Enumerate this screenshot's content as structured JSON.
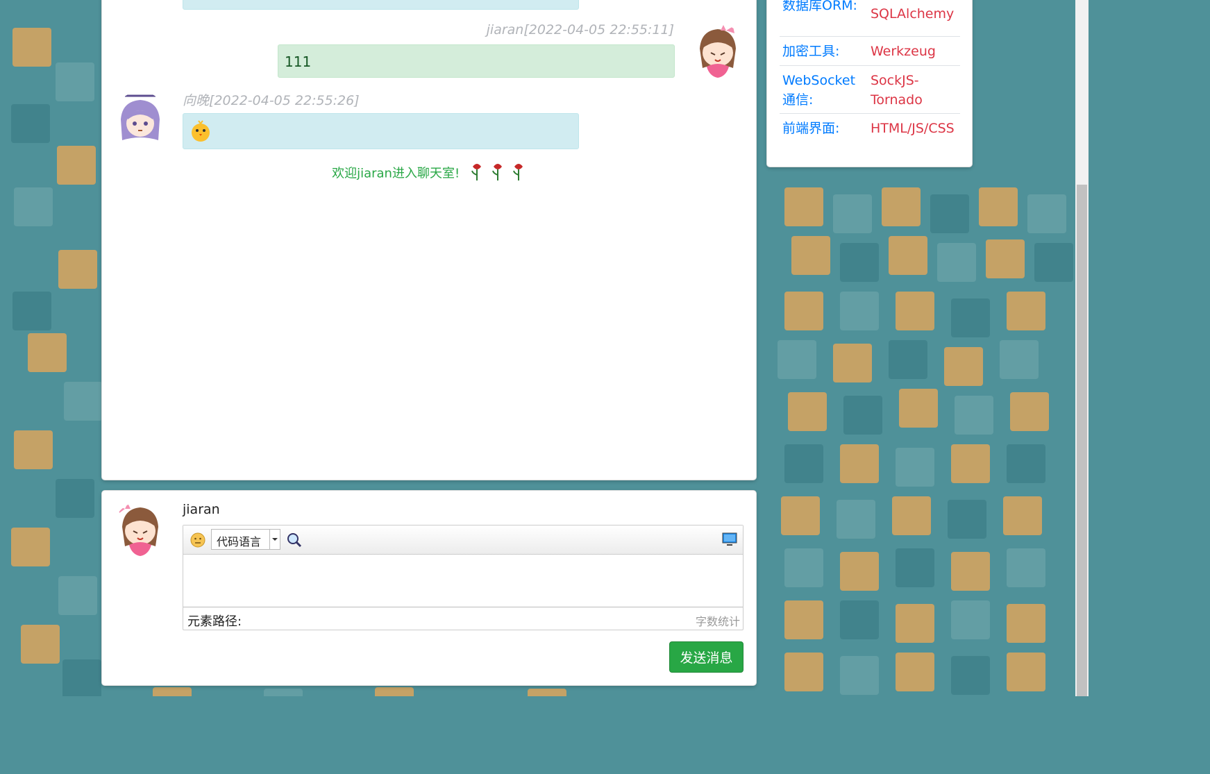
{
  "messages": [
    {
      "user": "jiaran",
      "time": "2022-04-05 22:55:11",
      "text": "111"
    },
    {
      "user": "向晚",
      "time": "2022-04-05 22:55:26"
    }
  ],
  "system_message": "欢迎jiaran进入聊天室!",
  "info": [
    {
      "key": "数据库ORM:",
      "value": "SQLAlchemy"
    },
    {
      "key": "加密工具:",
      "value": "Werkzeug"
    },
    {
      "key": "WebSocket通信:",
      "value": "SockJS-Tornado"
    },
    {
      "key": "前端界面:",
      "value": "HTML/JS/CSS"
    }
  ],
  "input": {
    "username": "jiaran",
    "code_language": "代码语言",
    "element_path_label": "元素路径:",
    "word_count_label": "字数统计",
    "send_label": "发送消息"
  },
  "icons": {
    "emoji": "emoji-icon",
    "search": "search-icon",
    "fullscreen": "monitor-icon",
    "rose": "rose-icon"
  }
}
